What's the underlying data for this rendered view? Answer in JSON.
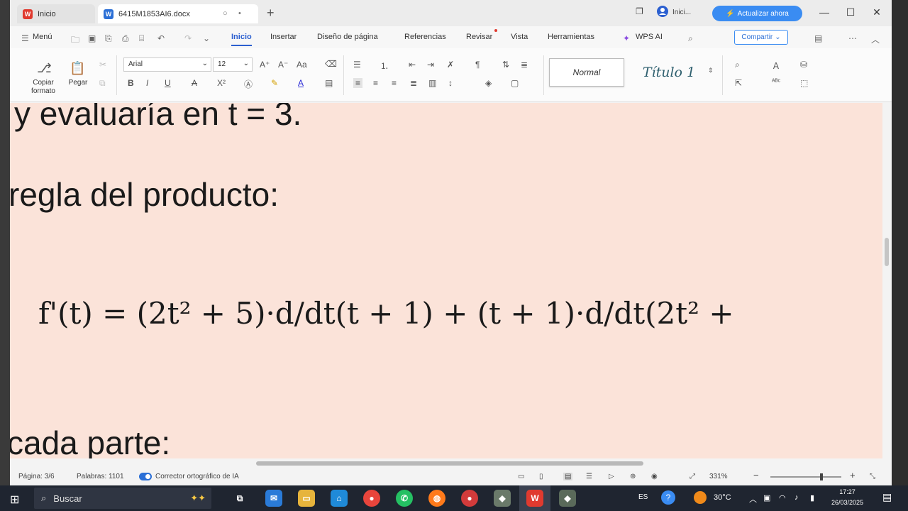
{
  "tabs": [
    {
      "label": "Inicio"
    },
    {
      "label": "6415M1853AI6.docx"
    }
  ],
  "titlebar": {
    "account_label": "Inici...",
    "upgrade_label": "Actualizar ahora"
  },
  "menu": {
    "items": [
      "Menú",
      "Inicio",
      "Insertar",
      "Diseño de página",
      "Referencias",
      "Revisar",
      "Vista",
      "Herramientas",
      "WPS AI"
    ],
    "share_label": "Compartir"
  },
  "ribbon": {
    "copy_format_label": "Copiar formato",
    "paste_label": "Pegar",
    "font_name": "Arial",
    "font_size": "12",
    "styles": {
      "normal": "Normal",
      "title": "Título 1"
    }
  },
  "document": {
    "line1": "y evaluaría en t = 3.",
    "line2": "regla del producto:",
    "formula": "f'(t) = (2t² + 5)·d/dt(t + 1) + (t + 1)·d/dt(2t² +",
    "line4": "cada parte:"
  },
  "status": {
    "page": "Página: 3/6",
    "words": "Palabras: 1101",
    "spellcheck": "Corrector ortográfico de IA",
    "zoom": "331%"
  },
  "taskbar": {
    "search_placeholder": "Buscar",
    "language": "ES",
    "temperature": "30°C",
    "time": "17:27",
    "date": "26/03/2025"
  },
  "colors": {
    "accent": "#2b6fd6",
    "upgrade": "#3a8cf2",
    "page_background": "#fbe3d9"
  }
}
